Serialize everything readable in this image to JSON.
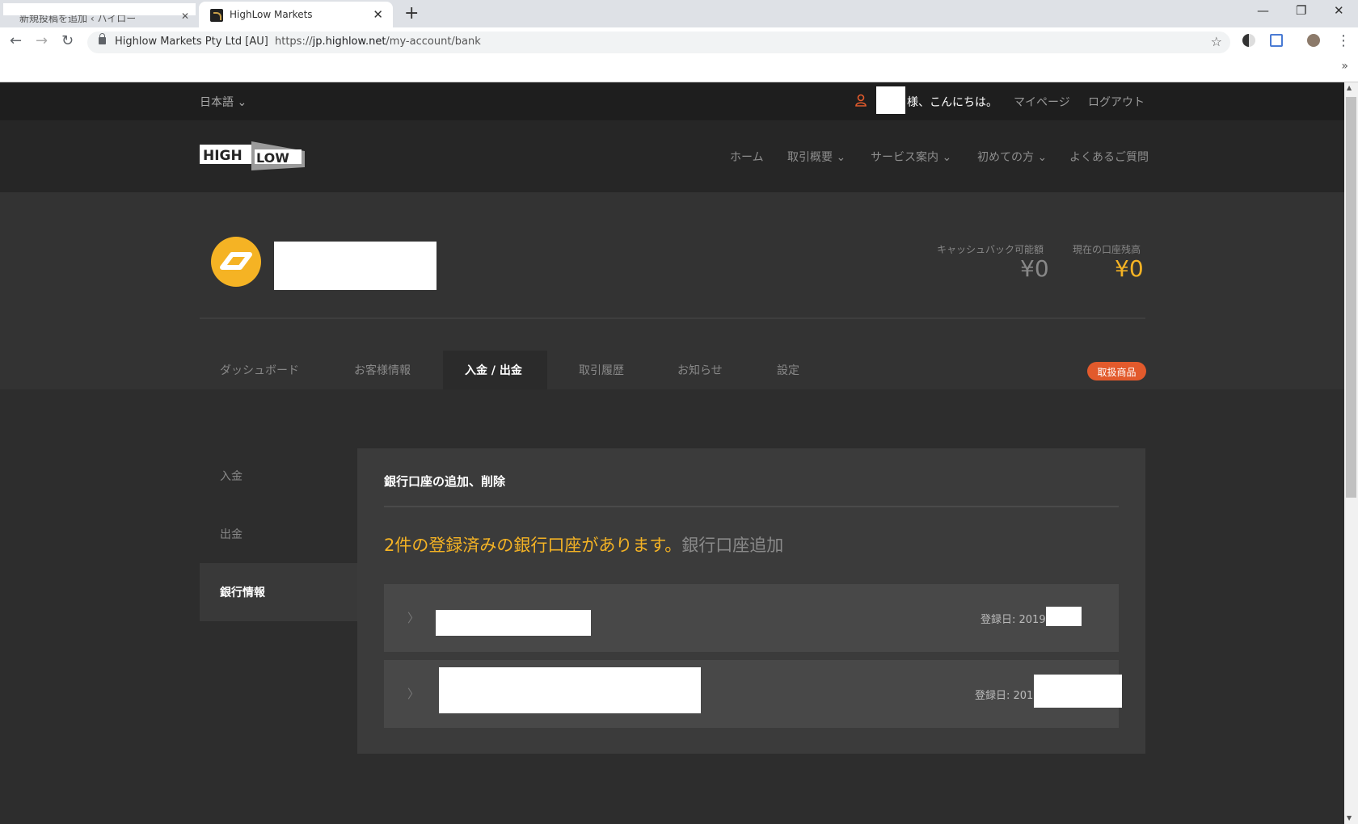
{
  "browser": {
    "inactive_tab": "新規投稿を追加 ‹ ハイロー",
    "active_tab_title": "HighLow Markets",
    "site_identity": "Highlow Markets Pty Ltd [AU]",
    "url_prefix": "https://",
    "url_domain": "jp.highlow.net",
    "url_path": "/my-account/bank"
  },
  "topbar": {
    "language": "日本語 ⌄",
    "greeting": "様、こんにちは。",
    "mypage": "マイページ",
    "logout": "ログアウト"
  },
  "nav": {
    "home": "ホーム",
    "trading": "取引概要 ⌄",
    "services": "サービス案内 ⌄",
    "beginners": "初めての方 ⌄",
    "faq": "よくあるご質問"
  },
  "balances": {
    "cashback_label": "キャッシュバック可能額",
    "cashback_value": "¥0",
    "balance_label": "現在の口座残高",
    "balance_value": "¥0"
  },
  "account_tabs": {
    "dashboard": "ダッシュボード",
    "customer_info": "お客様情報",
    "deposit_withdraw": "入金 / 出金",
    "history": "取引履歴",
    "notices": "お知らせ",
    "settings": "設定",
    "products_badge": "取扱商品"
  },
  "sidebar": {
    "deposit": "入金",
    "withdraw": "出金",
    "bank_info": "銀行情報"
  },
  "panel": {
    "title": "銀行口座の追加、削除",
    "headline": "2件の登録済みの銀行口座があります。",
    "add_link": "銀行口座追加",
    "rows": [
      {
        "registered": "登録日: 2019年"
      },
      {
        "registered": "登録日: 2016"
      }
    ]
  },
  "colors": {
    "accent_gold": "#f5b324",
    "badge_orange": "#e25a2c"
  }
}
